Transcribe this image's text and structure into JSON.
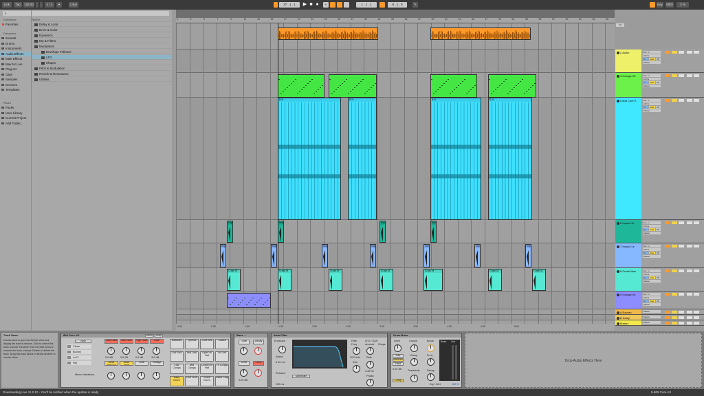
{
  "toolbar": {
    "link": "Link",
    "tap": "Tap",
    "tempo": "128.00",
    "sig": "4 / 4",
    "quant": "1 Bar",
    "pos": "37 . 1 . 1",
    "loop_start": "1 . 1 . 1",
    "loop_len": "9 . 1 . 0",
    "key": "Key",
    "midi": "MIDI",
    "cpu": "3 %"
  },
  "search": {
    "placeholder": "⌕"
  },
  "sidebar": {
    "collections_label": "Collections",
    "favorites": "Favorites",
    "categories_label": "Categories",
    "categories": [
      "Sounds",
      "Drums",
      "Instruments",
      "Audio Effects",
      "MIDI Effects",
      "Max for Live",
      "Plug-Ins",
      "Clips",
      "Samples",
      "Grooves",
      "Templates"
    ],
    "places_label": "Places",
    "places": [
      "Packs",
      "User Library",
      "Current Project",
      "Add Folder..."
    ]
  },
  "browser": {
    "header": "Name",
    "items": [
      "Delay & Loop",
      "Drive & Color",
      "Dynamics",
      "EQ & Filters",
      "Modulators",
      "Envelope Follower",
      "LFO",
      "Shaper",
      "Pitch & Modulation",
      "Reverb & Resonance",
      "Utilities"
    ]
  },
  "ruler": [
    "1",
    "3",
    "5",
    "7",
    "9",
    "11",
    "13",
    "15",
    "17",
    "19",
    "21",
    "23",
    "25",
    "27",
    "29",
    "31",
    "33",
    "35",
    "37",
    "39",
    "41",
    "43",
    "45",
    "47",
    "49",
    "51",
    "53",
    "55",
    "57",
    "59",
    "61",
    "63",
    "65"
  ],
  "timebar": [
    "0:00",
    "0:30",
    "1:00",
    "1:30",
    "2:00",
    "2:30",
    "3:00",
    "3:30",
    "4:00",
    "4:30",
    "5:00"
  ],
  "tracks": [
    {
      "name": "2 Audio",
      "color": "#eef06a"
    },
    {
      "name": "4 Garage Kit",
      "color": "#6cf04a"
    },
    {
      "name": "5 808 Core K",
      "color": "#3fe7ff"
    },
    {
      "name": "6 Impact Dr",
      "color": "#1fb79a"
    },
    {
      "name": "7 Impact Le",
      "color": "#86b8ff"
    },
    {
      "name": "8 Crash Man",
      "color": "#55e8d2"
    },
    {
      "name": "9 Garage Kit",
      "color": "#8d8dff"
    },
    {
      "name": "A Reverb",
      "color": "#f0b84a"
    },
    {
      "name": "B Delay",
      "color": "#f0c85a"
    },
    {
      "name": "Master",
      "color": "#f2e84a"
    }
  ],
  "clips": {
    "808_label": "B-N",
    "crash_label": "Crash M",
    "impact_label": "Imp"
  },
  "mixer": {
    "ext_in": "Ext. In",
    "all_ins": "All Ins",
    "master": "Master",
    "in": "In",
    "auto": "Auto",
    "off": "Off"
  },
  "info": {
    "title": "Track Name",
    "text": "Double-click to open the Device View and display the track's devices. Click to select this track; choose 'Rename' from the Edit menu to rename the track; choose 'Delete' to delete the track. Drag this track above or below another to reorder them."
  },
  "rack": {
    "title": "808 Core Kit",
    "send": "Send",
    "map": "Map",
    "new": "New",
    "chains": [
      "Clean",
      "Boomy",
      "Lo Fi",
      "Hot"
    ],
    "macros_row1": [
      "Low Gain",
      "Mid Gain",
      "High Gain",
      "Gain"
    ],
    "macros_row2": [
      "Drive Amount",
      "Drive Tone",
      "Glue",
      "Vintage"
    ],
    "vals1": [
      "0.0 dB",
      "0.0 dB",
      "0.0 dB",
      "-3.0 dB"
    ],
    "variations": "Macro Variations"
  },
  "pads": [
    "Maracas",
    "Cymbal",
    "Cow Bell",
    "Claves",
    "Low Tom",
    "Mid Tom",
    "Open Hi Hat",
    "Hi Tom",
    "Low Conga",
    "Mid Conga",
    "Closed Hi Hat",
    "Hi Conga",
    "Bass Drum",
    "Rim Shot",
    "Snare Drum",
    "Hand Clap"
  ],
  "bass": {
    "title": "Bass ...",
    "tone": "Tone",
    "decay": "Decay",
    "drive": "Drive",
    "level": "Level",
    "val": "0.00 dB"
  },
  "autofilter": {
    "title": "Auto Filter",
    "envelope": "Envelope",
    "attack": "Attack",
    "release": "Release",
    "filter": "Filter",
    "freq": "Freq",
    "res": "Res",
    "lfo": "LFO / S&H",
    "amount": "Amount",
    "rate": "Rate",
    "phase": "Phase",
    "shape": "Shape",
    "sidechain": "Sidechain",
    "val_att": "6.00 ms",
    "val_rel": "200 ms",
    "val_freq": "22.0 kHz",
    "val_rate": "0.33 Hz"
  },
  "drumbuss": {
    "title": "Drum Buss",
    "drive": "Drive",
    "crunch": "Crunch",
    "boom": "Boom",
    "medium": "Medium",
    "hard": "Hard",
    "comp": "Comp",
    "damp": "Damp",
    "transients": "Transients",
    "freq": "Freq",
    "decay": "Decay",
    "drywet": "Dry / Wet",
    "val_drywet": "100 %",
    "bass": "Bass",
    "out": "Out",
    "soft": "Soft",
    "gain": "0.00 dB"
  },
  "drop_text": "Drop Audio Effects Here",
  "status": "Downloading Live 11.0.10 - You'll be notified when the update is ready",
  "status_right": "5-808 Core Kit"
}
